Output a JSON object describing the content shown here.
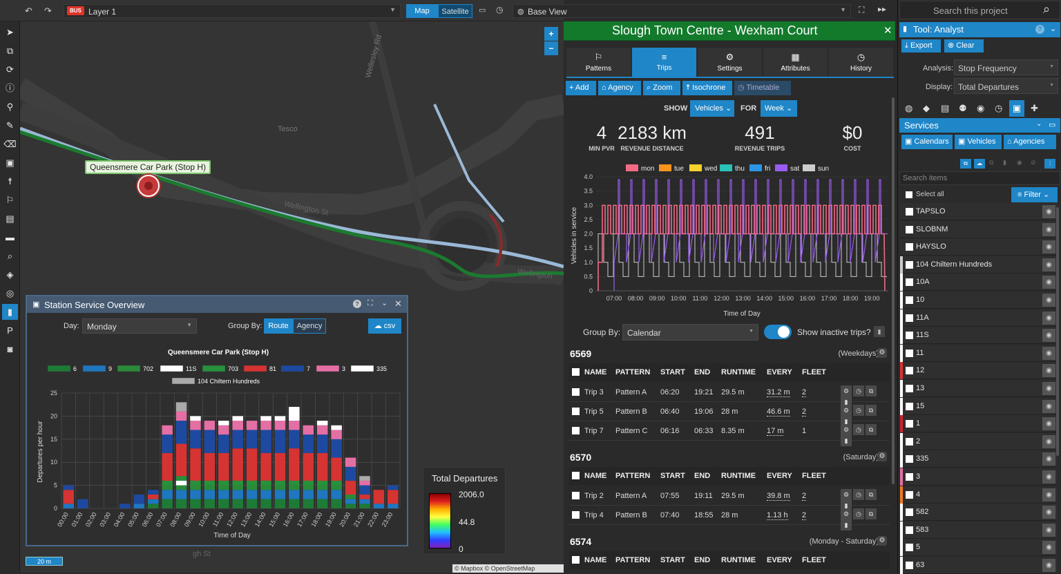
{
  "topbar": {
    "layer_badge": "BUS",
    "layer_name": "Layer 1",
    "map_tab": "Map",
    "satellite_tab": "Satellite",
    "base_view": "Base View"
  },
  "map": {
    "stop_label": "Queensmere Car Park (Stop H)",
    "place_tesco": "Tesco",
    "road_wellesley": "Wellesley Rd",
    "road_wellington_1": "Wellington St",
    "road_wellington_2": "Wellington",
    "road_high": "gh St",
    "scale": "20 m",
    "attribution": "© Mapbox © OpenStreetMap contributors"
  },
  "legend": {
    "title": "Total Departures",
    "max": "2006.0",
    "mid": "44.8",
    "min": "0"
  },
  "overview": {
    "title": "Station Service Overview",
    "day_label": "Day:",
    "day_value": "Monday",
    "group_label": "Group By:",
    "group_route": "Route",
    "group_agency": "Agency",
    "csv_label": "csv"
  },
  "chart_data": [
    {
      "type": "bar",
      "title": "Queensmere Car Park (Stop H)",
      "xlabel": "Time of Day",
      "ylabel": "Departures per hour",
      "ylim": [
        0,
        25
      ],
      "yticks": [
        "0",
        "5",
        "10",
        "15",
        "20",
        "25"
      ],
      "stacked": true,
      "categories": [
        "00:00",
        "01:00",
        "02:00",
        "03:00",
        "04:00",
        "05:00",
        "06:00",
        "07:00",
        "08:00",
        "09:00",
        "10:00",
        "11:00",
        "12:00",
        "13:00",
        "14:00",
        "15:00",
        "16:00",
        "17:00",
        "18:00",
        "19:00",
        "20:00",
        "21:00",
        "22:00",
        "23:00"
      ],
      "series": [
        {
          "name": "6",
          "color": "#1e7b36",
          "values": [
            0,
            0,
            0,
            0,
            0,
            0,
            1,
            2,
            2,
            2,
            2,
            2,
            2,
            2,
            2,
            2,
            2,
            2,
            2,
            2,
            1,
            1,
            0,
            0
          ]
        },
        {
          "name": "9",
          "color": "#1f77c0",
          "values": [
            1,
            0,
            0,
            0,
            0,
            1,
            1,
            2,
            2,
            2,
            2,
            2,
            2,
            2,
            2,
            2,
            2,
            2,
            2,
            2,
            1,
            1,
            1,
            1
          ]
        },
        {
          "name": "702",
          "color": "#2a8a3a",
          "values": [
            0,
            0,
            0,
            0,
            0,
            0,
            0,
            1,
            1,
            1,
            1,
            1,
            1,
            1,
            1,
            1,
            1,
            1,
            1,
            1,
            1,
            0,
            0,
            0
          ]
        },
        {
          "name": "11S",
          "color": "#ffffff",
          "values": [
            0,
            0,
            0,
            0,
            0,
            0,
            0,
            0,
            1,
            0,
            0,
            0,
            0,
            0,
            0,
            0,
            0,
            0,
            0,
            0,
            0,
            0,
            0,
            0
          ]
        },
        {
          "name": "703",
          "color": "#27913c",
          "values": [
            0,
            0,
            0,
            0,
            0,
            0,
            0,
            1,
            1,
            1,
            1,
            1,
            1,
            1,
            1,
            1,
            1,
            1,
            1,
            1,
            0,
            0,
            0,
            0
          ]
        },
        {
          "name": "81",
          "color": "#d63333",
          "values": [
            3,
            0,
            0,
            0,
            0,
            0,
            1,
            6,
            7,
            7,
            6,
            6,
            7,
            7,
            6,
            6,
            7,
            6,
            6,
            5,
            3,
            1,
            3,
            3
          ]
        },
        {
          "name": "7",
          "color": "#1d4aa0",
          "values": [
            1,
            2,
            0,
            0,
            1,
            2,
            1,
            4,
            5,
            4,
            5,
            4,
            4,
            4,
            5,
            5,
            4,
            4,
            4,
            4,
            3,
            2,
            0,
            1
          ]
        },
        {
          "name": "3",
          "color": "#e46fa4",
          "values": [
            0,
            0,
            0,
            0,
            0,
            0,
            0,
            2,
            2,
            2,
            2,
            2,
            2,
            2,
            2,
            2,
            2,
            2,
            2,
            2,
            2,
            1,
            0,
            0
          ]
        },
        {
          "name": "335",
          "color": "#ffffff",
          "values": [
            0,
            0,
            0,
            0,
            0,
            0,
            0,
            0,
            0,
            1,
            0,
            1,
            1,
            0,
            1,
            1,
            3,
            0,
            1,
            1,
            0,
            0,
            0,
            0
          ]
        },
        {
          "name": "104 Chiltern Hundreds",
          "color": "#aaaaaa",
          "values": [
            0,
            0,
            0,
            0,
            0,
            0,
            0,
            0,
            2,
            0,
            0,
            0,
            0,
            0,
            0,
            0,
            0,
            0,
            0,
            0,
            0,
            1,
            0,
            0
          ]
        }
      ]
    },
    {
      "type": "line",
      "xlabel": "Time of Day",
      "ylabel": "Vehicles in service",
      "ylim": [
        0,
        4.0
      ],
      "yticks": [
        "0",
        "0.5",
        "1.0",
        "1.5",
        "2.0",
        "2.5",
        "3.0",
        "3.5",
        "4.0"
      ],
      "xticks": [
        "07:00",
        "08:00",
        "09:00",
        "10:00",
        "11:00",
        "12:00",
        "13:00",
        "14:00",
        "15:00",
        "16:00",
        "17:00",
        "18:00",
        "19:00"
      ],
      "series": [
        {
          "name": "mon",
          "color": "#f26a86"
        },
        {
          "name": "tue",
          "color": "#f7941d"
        },
        {
          "name": "wed",
          "color": "#f7d22c"
        },
        {
          "name": "thu",
          "color": "#2ac3b9"
        },
        {
          "name": "fri",
          "color": "#2b95e6"
        },
        {
          "name": "sat",
          "color": "#9a5cf0"
        },
        {
          "name": "sun",
          "color": "#cccccc"
        }
      ]
    }
  ],
  "project": {
    "title": "Slough Town Centre - Wexham Court",
    "tabs": [
      "Patterns",
      "Trips",
      "Settings",
      "Attributes",
      "History"
    ],
    "actions": [
      "Add",
      "Agency",
      "Zoom",
      "Isochrone",
      "Timetable"
    ],
    "show_label": "SHOW",
    "show_value": "Vehicles",
    "for_label": "FOR",
    "for_value": "Week",
    "stats": [
      {
        "value": "4",
        "label": "MIN PVR"
      },
      {
        "value": "2183 km",
        "label": "REVENUE DISTANCE"
      },
      {
        "value": "491",
        "label": "REVENUE TRIPS"
      },
      {
        "value": "$0",
        "label": "COST"
      }
    ],
    "group_label": "Group By:",
    "group_value": "Calendar",
    "inactive_label": "Show inactive trips?",
    "headers": [
      "NAME",
      "PATTERN",
      "START",
      "END",
      "RUNTIME",
      "EVERY",
      "FLEET"
    ],
    "calendars": [
      {
        "id": "6569",
        "desc": "(Weekdays)",
        "trips": [
          {
            "name": "Trip 3",
            "pattern": "Pattern A",
            "start": "06:20",
            "end": "19:21",
            "runtime": "29.5 m",
            "every": "31.2 m",
            "fleet": "2"
          },
          {
            "name": "Trip 5",
            "pattern": "Pattern B",
            "start": "06:40",
            "end": "19:06",
            "runtime": "28 m",
            "every": "46.6 m",
            "fleet": "2"
          },
          {
            "name": "Trip 7",
            "pattern": "Pattern C",
            "start": "06:16",
            "end": "06:33",
            "runtime": "8.35 m",
            "every": "17 m",
            "fleet": "1"
          }
        ]
      },
      {
        "id": "6570",
        "desc": "(Saturday)",
        "trips": [
          {
            "name": "Trip 2",
            "pattern": "Pattern A",
            "start": "07:55",
            "end": "19:11",
            "runtime": "29.5 m",
            "every": "39.8 m",
            "fleet": "2"
          },
          {
            "name": "Trip 4",
            "pattern": "Pattern B",
            "start": "07:40",
            "end": "18:55",
            "runtime": "28 m",
            "every": "1.13 h",
            "fleet": "2"
          }
        ]
      },
      {
        "id": "6574",
        "desc": "(Monday - Saturday)",
        "trips": []
      }
    ]
  },
  "sidebar": {
    "search_placeholder": "Search this project",
    "tool_title": "Tool: Analyst",
    "export": "Export",
    "clear": "Clear",
    "analysis_label": "Analysis:",
    "analysis_value": "Stop Frequency",
    "display_label": "Display:",
    "display_value": "Total Departures",
    "services_title": "Services",
    "sub_buttons": [
      "Calendars",
      "Vehicles",
      "Agencies"
    ],
    "search_items_placeholder": "Search items",
    "select_all": "Select all",
    "filter": "Filter",
    "items": [
      {
        "label": "TAPSLO",
        "color": ""
      },
      {
        "label": "SLOBNM",
        "color": ""
      },
      {
        "label": "HAYSLO",
        "color": ""
      },
      {
        "label": "104 Chiltern Hundreds",
        "color": "#cccccc"
      },
      {
        "label": "10A",
        "color": "#ffffff"
      },
      {
        "label": "10",
        "color": "#ffffff"
      },
      {
        "label": "11A",
        "color": "#ffffff"
      },
      {
        "label": "11S",
        "color": "#ffffff"
      },
      {
        "label": "11",
        "color": "#ffffff"
      },
      {
        "label": "12",
        "color": "#d63333"
      },
      {
        "label": "13",
        "color": "#ffffff"
      },
      {
        "label": "15",
        "color": "#ffffff"
      },
      {
        "label": "1",
        "color": "#c8252e"
      },
      {
        "label": "2",
        "color": "#ffffff"
      },
      {
        "label": "335",
        "color": "#ffffff"
      },
      {
        "label": "3",
        "color": "#e46fa4"
      },
      {
        "label": "4",
        "color": "#f07a24"
      },
      {
        "label": "582",
        "color": "#ffffff"
      },
      {
        "label": "583",
        "color": "#ffffff"
      },
      {
        "label": "5",
        "color": "#ffffff"
      },
      {
        "label": "63",
        "color": "#ffffff"
      }
    ]
  }
}
